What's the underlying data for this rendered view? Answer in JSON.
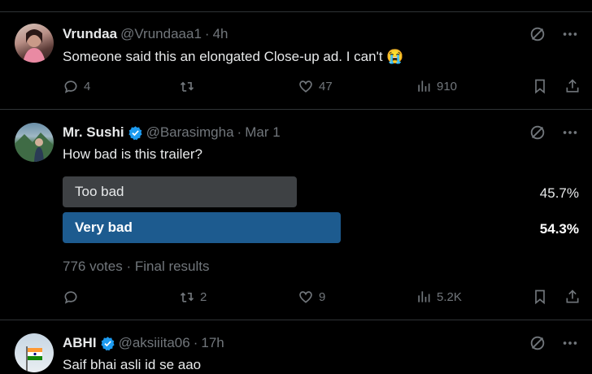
{
  "theme": {
    "background": "#000000",
    "text": "#e7e9ea",
    "muted": "#71767b",
    "accent": "#1d9bf0",
    "divider": "#2f3336",
    "poll_winner": "#1d5b8f",
    "poll_other": "#3e4144"
  },
  "tweets": [
    {
      "name": "Vrundaa",
      "handle": "@Vrundaaa1",
      "separator": "·",
      "time": "4h",
      "verified": false,
      "text": "Someone said this an elongated Close-up ad. I can't 😭",
      "replies": "4",
      "retweets": "",
      "likes": "47",
      "views": "910",
      "icons": {
        "avatar": "avatar-photo",
        "grok": "grok-icon",
        "more": "more-icon"
      }
    },
    {
      "name": "Mr. Sushi",
      "handle": "@Barasimgha",
      "separator": "·",
      "time": "Mar 1",
      "verified": true,
      "text": "How bad is this trailer?",
      "poll": {
        "options": [
          {
            "label": "Too bad",
            "percent": "45.7%",
            "value": 45.7,
            "winner": false
          },
          {
            "label": "Very bad",
            "percent": "54.3%",
            "value": 54.3,
            "winner": true
          }
        ],
        "votes": "776 votes",
        "separator": "·",
        "status": "Final results"
      },
      "replies": "",
      "retweets": "2",
      "likes": "9",
      "views": "5.2K"
    },
    {
      "name": "ABHI",
      "handle": "@aksiiita06",
      "separator": "·",
      "time": "17h",
      "verified": true,
      "text": "Saif bhai asli id se aao"
    }
  ]
}
